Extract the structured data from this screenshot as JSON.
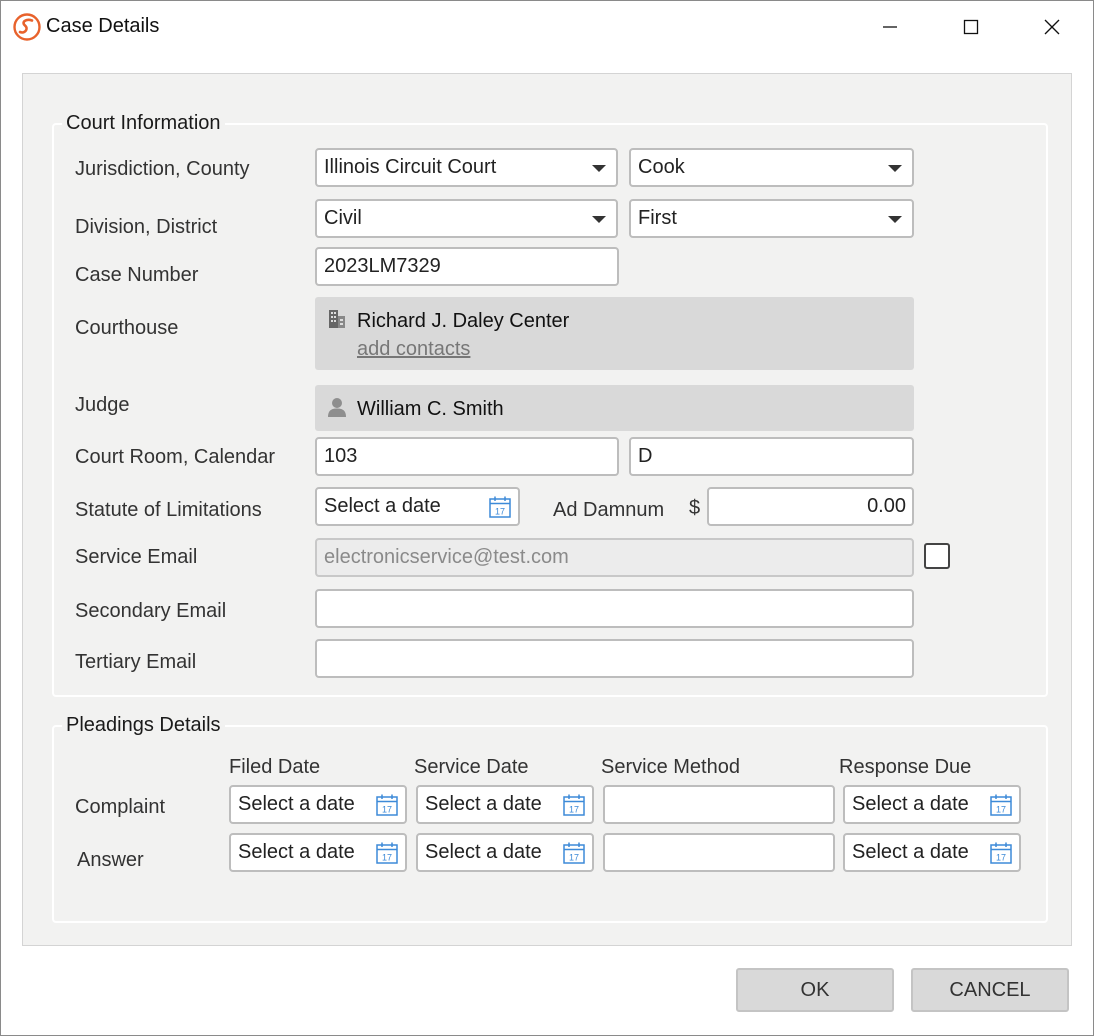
{
  "window": {
    "title": "Case Details"
  },
  "court": {
    "legend": "Court Information",
    "labels": {
      "jurisdiction": "Jurisdiction, County",
      "division": "Division, District",
      "case_number": "Case Number",
      "courthouse": "Courthouse",
      "judge": "Judge",
      "court_room": "Court Room, Calendar",
      "statute": "Statute of Limitations",
      "ad_damnum": "Ad Damnum",
      "currency": "$",
      "service_email": "Service Email",
      "secondary_email": "Secondary Email",
      "tertiary_email": "Tertiary Email"
    },
    "jurisdiction": "Illinois Circuit Court",
    "county": "Cook",
    "division": "Civil",
    "district": "First",
    "case_number": "2023LM7329",
    "courthouse": {
      "name": "Richard J. Daley Center",
      "link": "add contacts"
    },
    "judge": "William C. Smith",
    "court_room": "103",
    "calendar": "D",
    "statute_placeholder": "Select a date",
    "ad_damnum": "0.00",
    "service_email": "electronicservice@test.com",
    "secondary_email": "",
    "tertiary_email": ""
  },
  "pleadings": {
    "legend": "Pleadings Details",
    "columns": [
      "Filed Date",
      "Service Date",
      "Service Method",
      "Response Due"
    ],
    "rows": [
      {
        "label": "Complaint",
        "filed": "Select a date",
        "service": "Select a date",
        "method": "",
        "due": "Select a date"
      },
      {
        "label": "Answer",
        "filed": "Select a date",
        "service": "Select a date",
        "method": "",
        "due": "Select a date"
      }
    ]
  },
  "buttons": {
    "ok": "OK",
    "cancel": "CANCEL"
  },
  "colors": {
    "accent": "#e8622c",
    "panel": "#d9d9d9",
    "content_bg": "#f2f2f1"
  }
}
